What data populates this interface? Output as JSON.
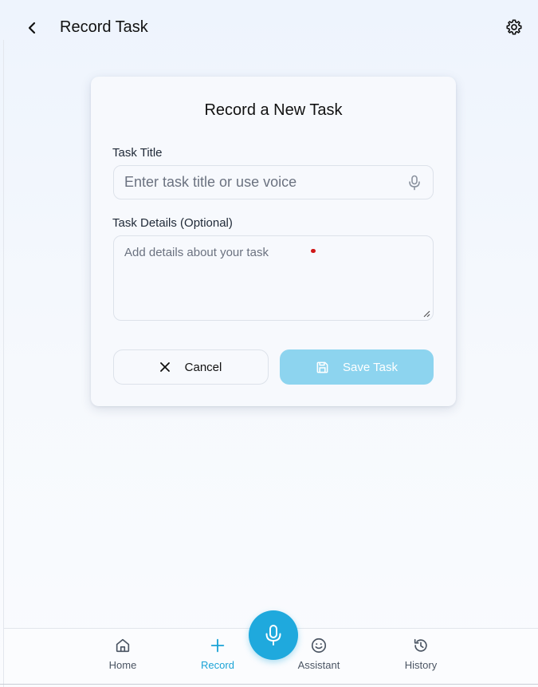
{
  "header": {
    "title": "Record Task",
    "back_icon": "chevron-left-icon",
    "settings_icon": "gear-icon"
  },
  "form": {
    "heading": "Record a New Task",
    "title_label": "Task Title",
    "title_placeholder": "Enter task title or use voice",
    "title_value": "",
    "details_label": "Task Details (Optional)",
    "details_placeholder": "Add details about your task",
    "details_value": "",
    "cancel_label": "Cancel",
    "save_label": "Save Task",
    "save_disabled": true
  },
  "nav": {
    "items": [
      {
        "label": "Home",
        "icon": "home-icon",
        "active": false
      },
      {
        "label": "Record",
        "icon": "plus-icon",
        "active": true
      },
      {
        "label": "Assistant",
        "icon": "smile-icon",
        "active": false
      },
      {
        "label": "History",
        "icon": "history-icon",
        "active": false
      }
    ],
    "fab_icon": "microphone-icon"
  },
  "colors": {
    "accent": "#1fa9dd",
    "save_disabled_bg": "#8dd4ef",
    "active_nav": "#1aa3d6",
    "background": "#eef4fd",
    "card": "#f7f9fd"
  }
}
